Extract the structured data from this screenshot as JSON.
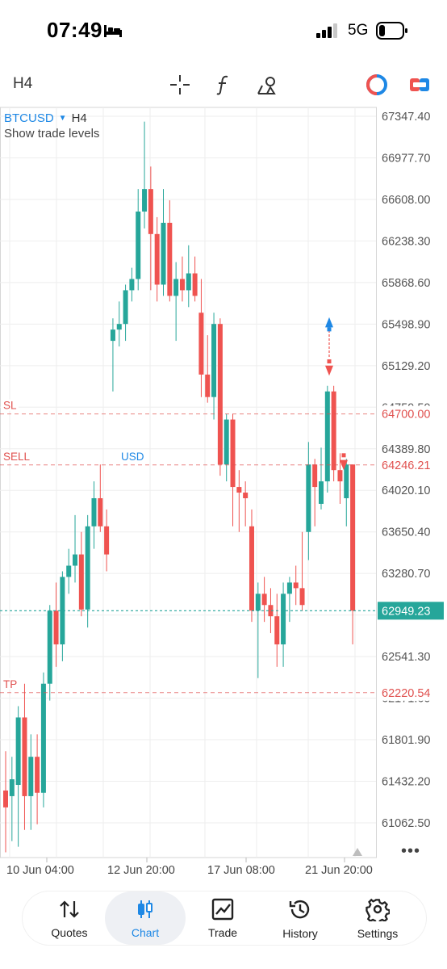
{
  "status": {
    "time": "07:49",
    "network": "5G"
  },
  "toolbar": {
    "timeframe": "H4",
    "icons": [
      "crosshair-icon",
      "function-icon",
      "objects-icon",
      "one-click-trading-icon",
      "trade-panel-icon"
    ]
  },
  "chart": {
    "symbol": "BTCUSD",
    "timeframe": "H4",
    "show_levels": "Show trade levels",
    "y_ticks": [
      "67347.40",
      "66977.70",
      "66608.00",
      "66238.30",
      "65868.60",
      "65498.90",
      "65129.20",
      "64759.50",
      "64389.80",
      "64020.10",
      "63650.40",
      "63280.70",
      "62910.90",
      "62541.30",
      "62171.60",
      "61801.90",
      "61432.20",
      "61062.50"
    ],
    "x_ticks": [
      "10 Jun 04:00",
      "12 Jun 20:00",
      "17 Jun 08:00",
      "21 Jun 20:00"
    ],
    "levels": [
      {
        "label": "SL",
        "price": "64700.00",
        "value": 64700.0,
        "color": "#e0514f"
      },
      {
        "label": "SELL",
        "price": "64246.21",
        "value": 64246.21,
        "color": "#e0514f",
        "partial_text": "USD"
      },
      {
        "label": "TP",
        "price": "62220.54",
        "value": 62220.54,
        "color": "#e0514f"
      }
    ],
    "current_price": "62949.23",
    "current_value": 62949.23,
    "colors": {
      "bull": "#26a69a",
      "bear": "#ef5350",
      "grid": "#eeeeee",
      "bid": "#26a69a",
      "level": "#e0514f",
      "accent": "#1e88e5"
    }
  },
  "chart_data": {
    "type": "candlestick",
    "symbol": "BTCUSD",
    "timeframe": "H4",
    "ylim": [
      60900,
      67500
    ],
    "candles": [
      {
        "o": 61350,
        "h": 61700,
        "l": 60800,
        "c": 61200
      },
      {
        "o": 61300,
        "h": 61650,
        "l": 60900,
        "c": 61450
      },
      {
        "o": 61400,
        "h": 62100,
        "l": 60850,
        "c": 62000
      },
      {
        "o": 62000,
        "h": 62300,
        "l": 61000,
        "c": 61300
      },
      {
        "o": 61300,
        "h": 61850,
        "l": 61000,
        "c": 61650
      },
      {
        "o": 61650,
        "h": 61850,
        "l": 61050,
        "c": 61330
      },
      {
        "o": 61330,
        "h": 62400,
        "l": 61200,
        "c": 62300
      },
      {
        "o": 62300,
        "h": 63000,
        "l": 62150,
        "c": 62950
      },
      {
        "o": 62950,
        "h": 63200,
        "l": 62450,
        "c": 62650
      },
      {
        "o": 62650,
        "h": 63300,
        "l": 62500,
        "c": 63250
      },
      {
        "o": 63250,
        "h": 63500,
        "l": 63100,
        "c": 63350
      },
      {
        "o": 63350,
        "h": 63800,
        "l": 63200,
        "c": 63450
      },
      {
        "o": 63450,
        "h": 63650,
        "l": 62900,
        "c": 62960
      },
      {
        "o": 62960,
        "h": 63800,
        "l": 62800,
        "c": 63700
      },
      {
        "o": 63700,
        "h": 64100,
        "l": 63500,
        "c": 63950
      },
      {
        "o": 63950,
        "h": 64250,
        "l": 63650,
        "c": 63700
      },
      {
        "o": 63700,
        "h": 63850,
        "l": 63300,
        "c": 63450
      },
      {
        "o": 65350,
        "h": 65550,
        "l": 64900,
        "c": 65450
      },
      {
        "o": 65450,
        "h": 65700,
        "l": 65300,
        "c": 65500
      },
      {
        "o": 65500,
        "h": 65850,
        "l": 65350,
        "c": 65800
      },
      {
        "o": 65800,
        "h": 66000,
        "l": 65700,
        "c": 65900
      },
      {
        "o": 65900,
        "h": 66700,
        "l": 65800,
        "c": 66500
      },
      {
        "o": 66500,
        "h": 67300,
        "l": 66350,
        "c": 66700
      },
      {
        "o": 66700,
        "h": 66900,
        "l": 65800,
        "c": 66300
      },
      {
        "o": 66300,
        "h": 66450,
        "l": 65700,
        "c": 65850
      },
      {
        "o": 65850,
        "h": 66700,
        "l": 65750,
        "c": 66400
      },
      {
        "o": 66400,
        "h": 66600,
        "l": 65700,
        "c": 65750
      },
      {
        "o": 65750,
        "h": 66050,
        "l": 65350,
        "c": 65900
      },
      {
        "o": 65900,
        "h": 66100,
        "l": 65700,
        "c": 65800
      },
      {
        "o": 65800,
        "h": 66200,
        "l": 65650,
        "c": 65950
      },
      {
        "o": 65950,
        "h": 66100,
        "l": 65700,
        "c": 65750
      },
      {
        "o": 65600,
        "h": 65900,
        "l": 64850,
        "c": 65050
      },
      {
        "o": 65050,
        "h": 65400,
        "l": 64800,
        "c": 64850
      },
      {
        "o": 64850,
        "h": 65600,
        "l": 64650,
        "c": 65500
      },
      {
        "o": 65500,
        "h": 65550,
        "l": 64150,
        "c": 64250
      },
      {
        "o": 64250,
        "h": 64700,
        "l": 64100,
        "c": 64650
      },
      {
        "o": 64650,
        "h": 64700,
        "l": 63700,
        "c": 64050
      },
      {
        "o": 64050,
        "h": 64200,
        "l": 63650,
        "c": 64000
      },
      {
        "o": 64000,
        "h": 64100,
        "l": 63700,
        "c": 63950
      },
      {
        "o": 63700,
        "h": 63850,
        "l": 62850,
        "c": 62950
      },
      {
        "o": 62950,
        "h": 63200,
        "l": 62350,
        "c": 63100
      },
      {
        "o": 63100,
        "h": 63250,
        "l": 62850,
        "c": 63000
      },
      {
        "o": 63000,
        "h": 63150,
        "l": 62750,
        "c": 62900
      },
      {
        "o": 62900,
        "h": 63100,
        "l": 62450,
        "c": 62650
      },
      {
        "o": 62650,
        "h": 63200,
        "l": 62450,
        "c": 63100
      },
      {
        "o": 63100,
        "h": 63250,
        "l": 62850,
        "c": 63200
      },
      {
        "o": 63200,
        "h": 63350,
        "l": 63000,
        "c": 63150
      },
      {
        "o": 63150,
        "h": 63650,
        "l": 62950,
        "c": 63000
      },
      {
        "o": 63650,
        "h": 64450,
        "l": 63400,
        "c": 64250
      },
      {
        "o": 64250,
        "h": 64300,
        "l": 63700,
        "c": 64050
      },
      {
        "o": 63900,
        "h": 64400,
        "l": 63850,
        "c": 64100
      },
      {
        "o": 64100,
        "h": 64950,
        "l": 64000,
        "c": 64900
      },
      {
        "o": 64900,
        "h": 64950,
        "l": 64100,
        "c": 64200
      },
      {
        "o": 64200,
        "h": 64350,
        "l": 63900,
        "c": 64100
      },
      {
        "o": 63950,
        "h": 64300,
        "l": 63700,
        "c": 64250
      },
      {
        "o": 64250,
        "h": 64250,
        "l": 62650,
        "c": 62950
      }
    ],
    "trade_levels": {
      "sl": 64700.0,
      "sell": 64246.21,
      "tp": 62220.54
    },
    "current_price": 62949.23
  },
  "nav": {
    "items": [
      {
        "label": "Quotes",
        "icon": "quotes-icon"
      },
      {
        "label": "Chart",
        "icon": "chart-icon"
      },
      {
        "label": "Trade",
        "icon": "trade-icon"
      },
      {
        "label": "History",
        "icon": "history-icon"
      },
      {
        "label": "Settings",
        "icon": "settings-icon"
      }
    ],
    "active": "Chart"
  }
}
